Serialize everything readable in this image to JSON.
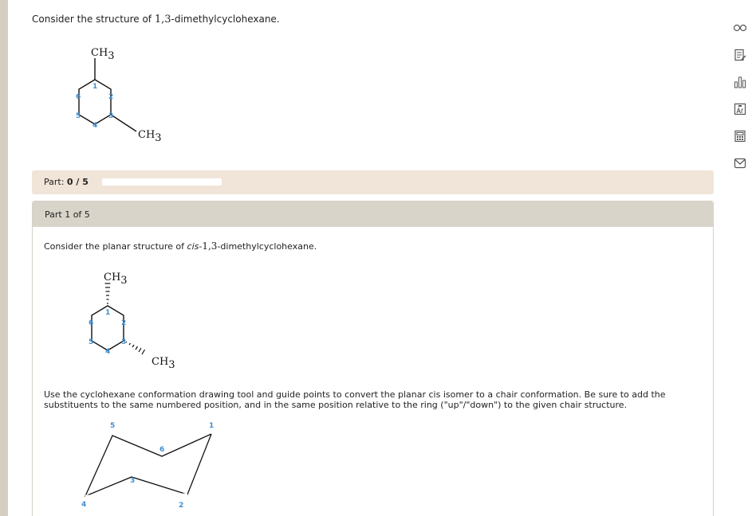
{
  "intro": {
    "before": "Consider the structure of ",
    "number": "1,3",
    "after": "-dimethylcyclohexane."
  },
  "molecule_main": {
    "ch3_top": "CH",
    "ch3_top_sub": "3",
    "ch3_right": "CH",
    "ch3_right_sub": "3",
    "ring_numbers": [
      "1",
      "2",
      "3",
      "4",
      "5",
      "6"
    ]
  },
  "progress": {
    "label": "Part:",
    "value": "0 / 5",
    "fraction": 0
  },
  "part": {
    "header": "Part 1 of 5",
    "question_before": "Consider the planar structure of ",
    "question_italic": "cis",
    "question_dash": "-",
    "question_number": "1,3",
    "question_after": "-dimethylcyclohexane.",
    "instructions": "Use the cyclohexane conformation drawing tool and guide points to convert the planar cis isomer to a chair conformation. Be sure to add the substituents to the same numbered position, and in the same position relative to the ring (\"up\"/\"down\") to the given chair structure."
  },
  "molecule_cis": {
    "ch3_top": "CH",
    "ch3_top_sub": "3",
    "ch3_right": "CH",
    "ch3_right_sub": "3",
    "ring_numbers": [
      "1",
      "2",
      "3",
      "4",
      "5",
      "6"
    ]
  },
  "chair": {
    "positions": [
      "1",
      "2",
      "3",
      "4",
      "5",
      "6"
    ]
  },
  "sidebar_icons": [
    "infinity-icon",
    "notes-icon",
    "bar-chart-icon",
    "periodic-table-icon",
    "calculator-icon",
    "mail-icon"
  ],
  "colors": {
    "accent_blue": "#3f8fd2",
    "progress_bg": "#f1e4d8",
    "header_bg": "#d8d4c9",
    "rail": "#d4cfc2"
  }
}
